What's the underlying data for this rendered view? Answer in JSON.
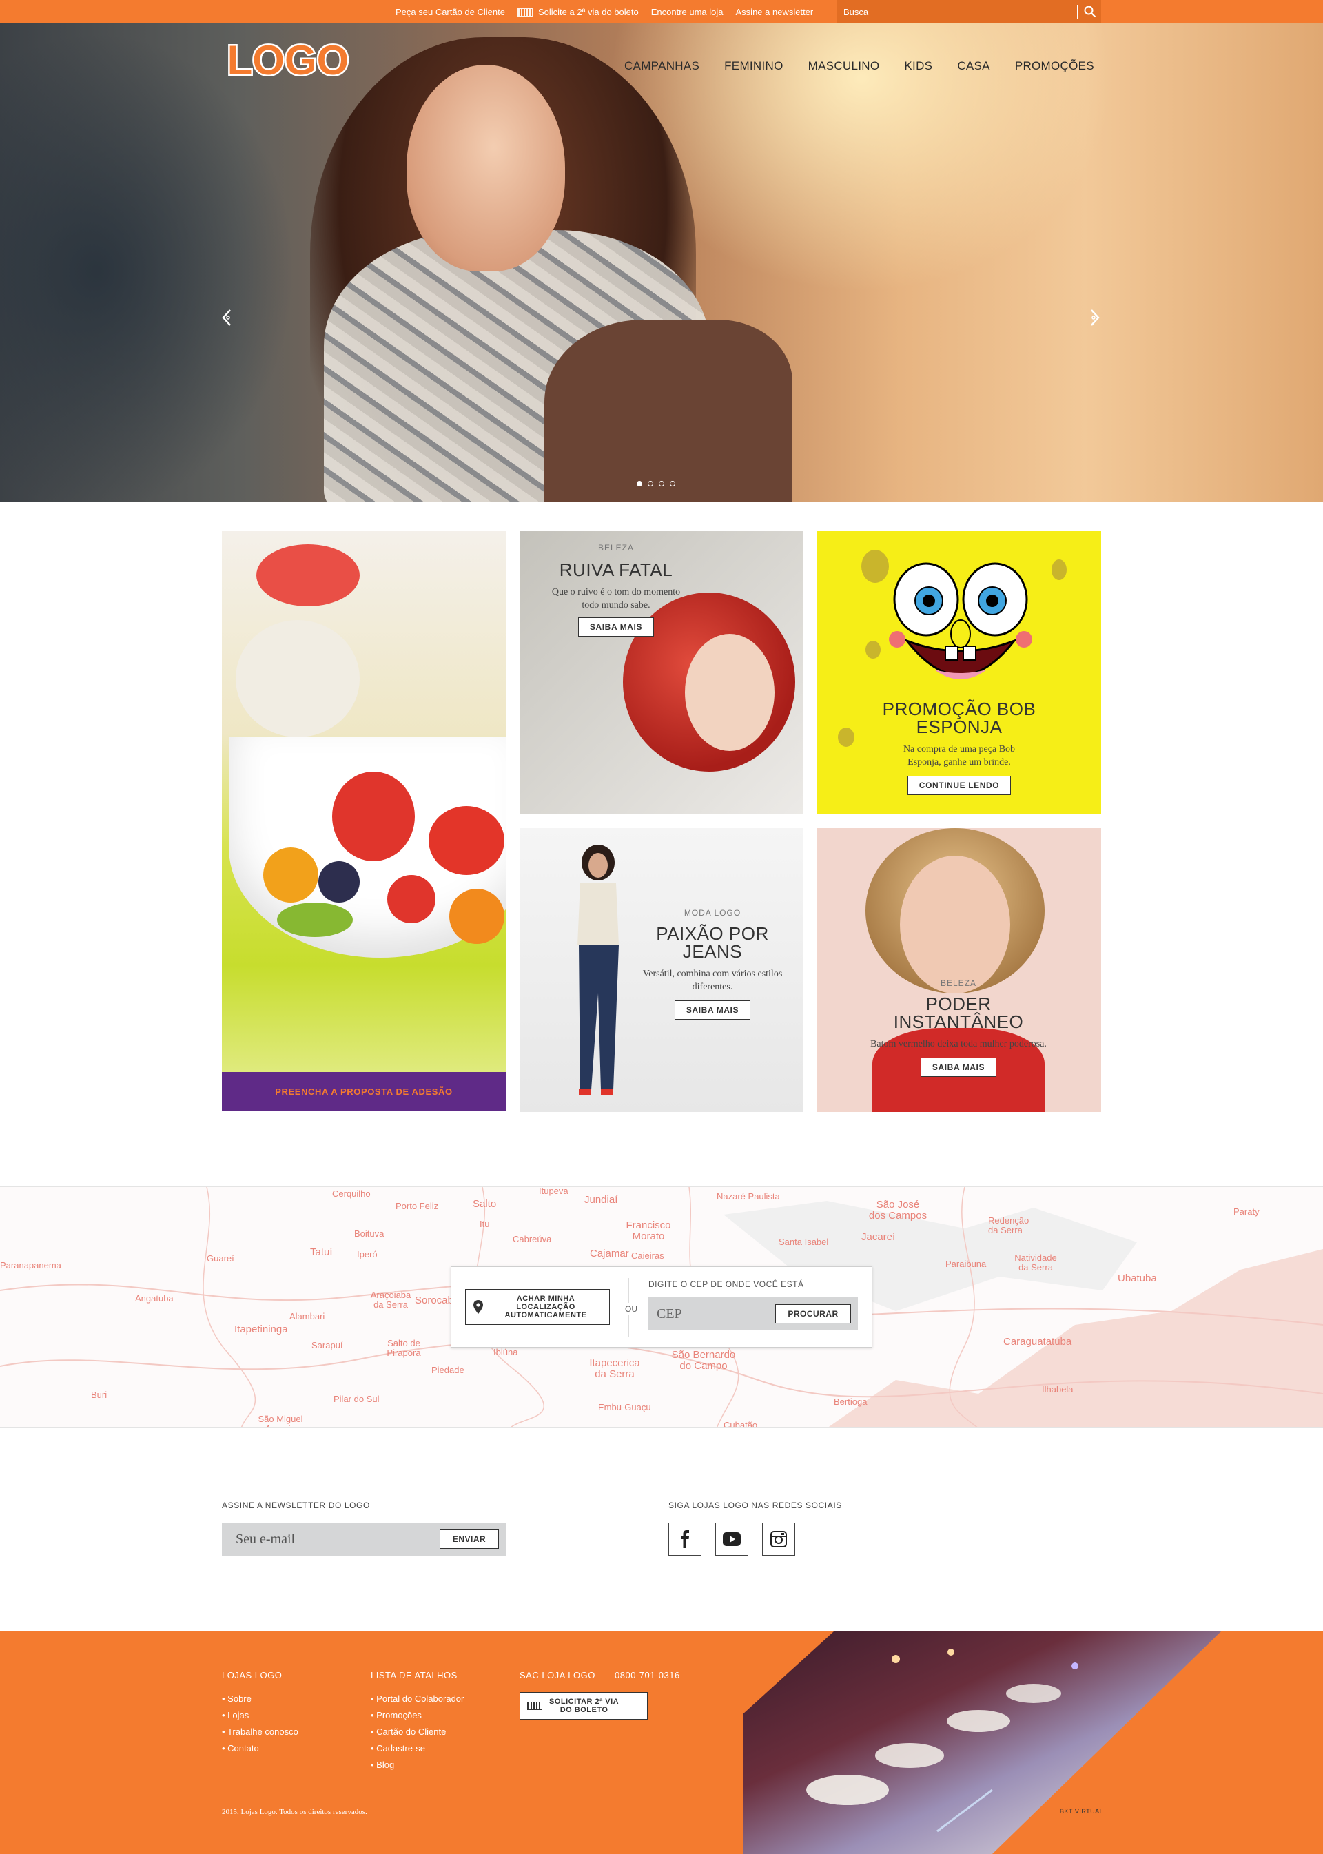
{
  "topbar": {
    "links": [
      "Peça seu Cartão de Cliente",
      "Solicite a 2ª via do boleto",
      "Encontre uma loja",
      "Assine a newsletter"
    ],
    "search_placeholder": "Busca",
    "search_icon": "search-icon"
  },
  "header": {
    "logo_text": "LOGO",
    "nav": [
      "CAMPANHAS",
      "FEMININO",
      "MASCULINO",
      "KIDS",
      "CASA",
      "PROMOÇÕES"
    ]
  },
  "hero": {
    "slide_count": 4,
    "active_slide": 1,
    "icons": [
      "arrow-left-icon",
      "arrow-right-icon"
    ]
  },
  "promos": {
    "fruit_cta": "PREENCHA A PROPOSTA DE ADESÃO",
    "ruiva": {
      "kicker": "BELEZA",
      "title": "RUIVA FATAL",
      "desc": "Que o ruivo é o tom do momento todo mundo sabe.",
      "button": "SAIBA MAIS"
    },
    "bob": {
      "title_line1": "PROMOÇÃO BOB",
      "title_line2": "ESPONJA",
      "desc": "Na compra de uma peça Bob Esponja, ganhe um brinde.",
      "button": "CONTINUE LENDO"
    },
    "jeans": {
      "kicker": "MODA LOGO",
      "title_line1": "PAIXÃO POR",
      "title_line2": "JEANS",
      "desc": "Versátil, combina com vários estilos diferentes.",
      "button": "SAIBA MAIS"
    },
    "poder": {
      "kicker": "BELEZA",
      "title_line1": "PODER",
      "title_line2": "INSTANTÂNEO",
      "desc": "Batom vermelho deixa toda mulher poderosa.",
      "button": "SAIBA MAIS"
    }
  },
  "map": {
    "cities": [
      "Cerquilho",
      "Porto Feliz",
      "Salto",
      "Itupeva",
      "Jundiaí",
      "Nazaré Paulista",
      "São José dos Campos",
      "Redenção da Serra",
      "Paraty",
      "Boituva",
      "Itu",
      "Cabreúva",
      "Francisco Morato",
      "Santa Isabel",
      "Jacareí",
      "Paranapanema",
      "Guareí",
      "Tatuí",
      "Iperó",
      "Cajamar",
      "Caieiras",
      "Paraibuna",
      "Natividade da Serra",
      "Ubatuba",
      "Angatuba",
      "Araçoiaba da Serra",
      "Sorocaba",
      "Alambari",
      "Itapetininga",
      "Sarapuí",
      "Salto de Pirapora",
      "Ibiúna",
      "Piedade",
      "Itapecerica da Serra",
      "São Bernardo do Campo",
      "Caraguatatuba",
      "Ilhabela",
      "Buri",
      "Pilar do Sul",
      "Embu-Guaçu",
      "Bertioga",
      "São Miguel Arcanjo",
      "Cubatão"
    ],
    "locator": {
      "geo_button": "ACHAR MINHA\nLOCALIZAÇÃO\nAUTOMATICAMENTE",
      "or_text": "OU",
      "cep_label": "DIGITE O CEP DE ONDE VOCÊ ESTÁ",
      "cep_placeholder": "CEP",
      "search_button": "PROCURAR",
      "pin_icon": "location-pin-icon"
    }
  },
  "newsletter": {
    "title": "ASSINE A NEWSLETTER DO LOGO",
    "placeholder": "Seu e-mail",
    "button": "ENVIAR"
  },
  "social": {
    "title": "SIGA LOJAS LOGO NAS REDES SOCIAIS",
    "icons": [
      "facebook-icon",
      "youtube-icon",
      "instagram-icon"
    ]
  },
  "footer": {
    "col1_title": "LOJAS LOGO",
    "col1_items": [
      "Sobre",
      "Lojas",
      "Trabalhe conosco",
      "Contato"
    ],
    "col2_title": "LISTA DE ATALHOS",
    "col2_items": [
      "Portal do Colaborador",
      "Promoções",
      "Cartão do Cliente",
      "Cadastre-se",
      "Blog"
    ],
    "sac_title": "SAC LOJA LOGO",
    "sac_phone": "0800-701-0316",
    "boleto_button": "SOLICITAR 2ª VIA\nDO BOLETO",
    "copyright": "2015, Lojas Logo. Todos os direitos reservados.",
    "credit": "BKT VIRTUAL"
  },
  "colors": {
    "brand_orange": "#f47b2f",
    "purple": "#5f2a87",
    "bob_yellow": "#f6ee17",
    "map_city": "#e9847a"
  }
}
